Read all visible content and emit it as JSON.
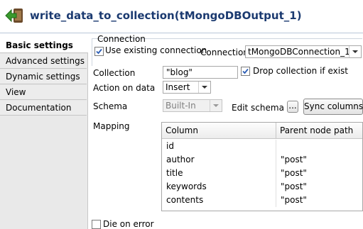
{
  "title": "write_data_to_collection(tMongoDBOutput_1)",
  "tabs": [
    {
      "label": "Basic settings",
      "active": true
    },
    {
      "label": "Advanced settings",
      "active": false
    },
    {
      "label": "Dynamic settings",
      "active": false
    },
    {
      "label": "View",
      "active": false
    },
    {
      "label": "Documentation",
      "active": false
    }
  ],
  "connection": {
    "group_label": "Connection",
    "use_existing_label": "Use existing connection",
    "use_existing_checked": true,
    "connection_label": "Connection",
    "connection_value": "tMongoDBConnection_1"
  },
  "collection": {
    "label": "Collection",
    "value": "\"blog\"",
    "drop_label": "Drop collection if exist",
    "drop_checked": true
  },
  "action": {
    "label": "Action on data",
    "value": "Insert"
  },
  "schema": {
    "label": "Schema",
    "value": "Built-In",
    "edit_label": "Edit schema",
    "edit_button": "...",
    "sync_button": "Sync columns"
  },
  "mapping": {
    "label": "Mapping",
    "headers": [
      "Column",
      "Parent node path"
    ],
    "rows": [
      {
        "column": "id",
        "path": ""
      },
      {
        "column": "author",
        "path": "\"post\""
      },
      {
        "column": "title",
        "path": "\"post\""
      },
      {
        "column": "keywords",
        "path": "\"post\""
      },
      {
        "column": "contents",
        "path": "\"post\""
      }
    ]
  },
  "die_on_error": {
    "label": "Die on error",
    "checked": false
  },
  "colors": {
    "title": "#1b3a70",
    "tick": "#2b5db5",
    "icon_green": "#3a9a2e"
  },
  "icons": {
    "component": "mongodb-output-icon"
  }
}
